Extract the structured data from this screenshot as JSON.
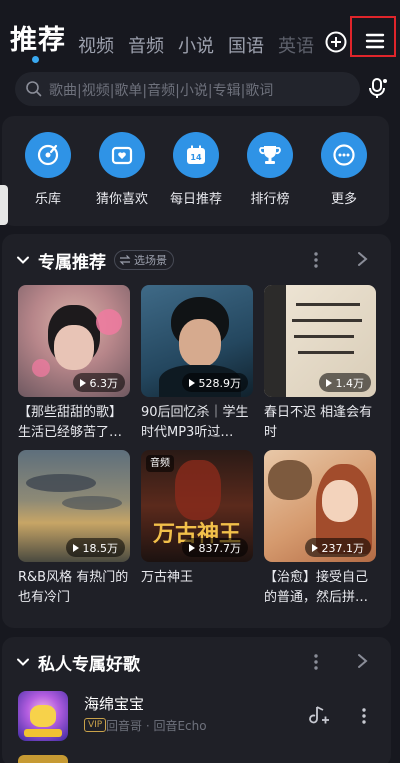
{
  "header": {
    "active_tab": "推荐",
    "tabs": [
      "视频",
      "音频",
      "小说",
      "国语",
      "英语"
    ]
  },
  "search": {
    "placeholder": "歌曲|视频|歌单|音频|小说|专辑|歌词"
  },
  "quick_menu": [
    {
      "label": "乐库",
      "icon": "disc-icon"
    },
    {
      "label": "猜你喜欢",
      "icon": "heart-radio-icon"
    },
    {
      "label": "每日推荐",
      "icon": "calendar-icon",
      "calendar_day": "14"
    },
    {
      "label": "排行榜",
      "icon": "trophy-icon"
    },
    {
      "label": "更多",
      "icon": "more-dots-icon"
    }
  ],
  "exclusive": {
    "title": "专属推荐",
    "scene_chip": "选场景",
    "cards": [
      {
        "plays": "6.3万",
        "title": "【那些甜甜的歌】生活已经够苦了…"
      },
      {
        "plays": "528.9万",
        "title": "90后回忆杀｜学生时代MP3听过…"
      },
      {
        "plays": "1.4万",
        "title": "春日不迟 相逢会有时"
      },
      {
        "plays": "18.5万",
        "title": "R&B风格 有热门的也有冷门"
      },
      {
        "plays": "837.7万",
        "title": "万古神王",
        "tag": "音频",
        "cover_text": "万古神王"
      },
      {
        "plays": "237.1万",
        "title": "【治愈】接受自己的普通，然后拼…"
      }
    ]
  },
  "private": {
    "title": "私人专属好歌",
    "song": {
      "name": "海绵宝宝",
      "vip": "VIP",
      "artist": "回音哥 · 回音Echo"
    }
  },
  "colors": {
    "accent": "#2f93e6",
    "background": "#17181f",
    "card": "#1f2027",
    "highlight": "#e0252b"
  }
}
